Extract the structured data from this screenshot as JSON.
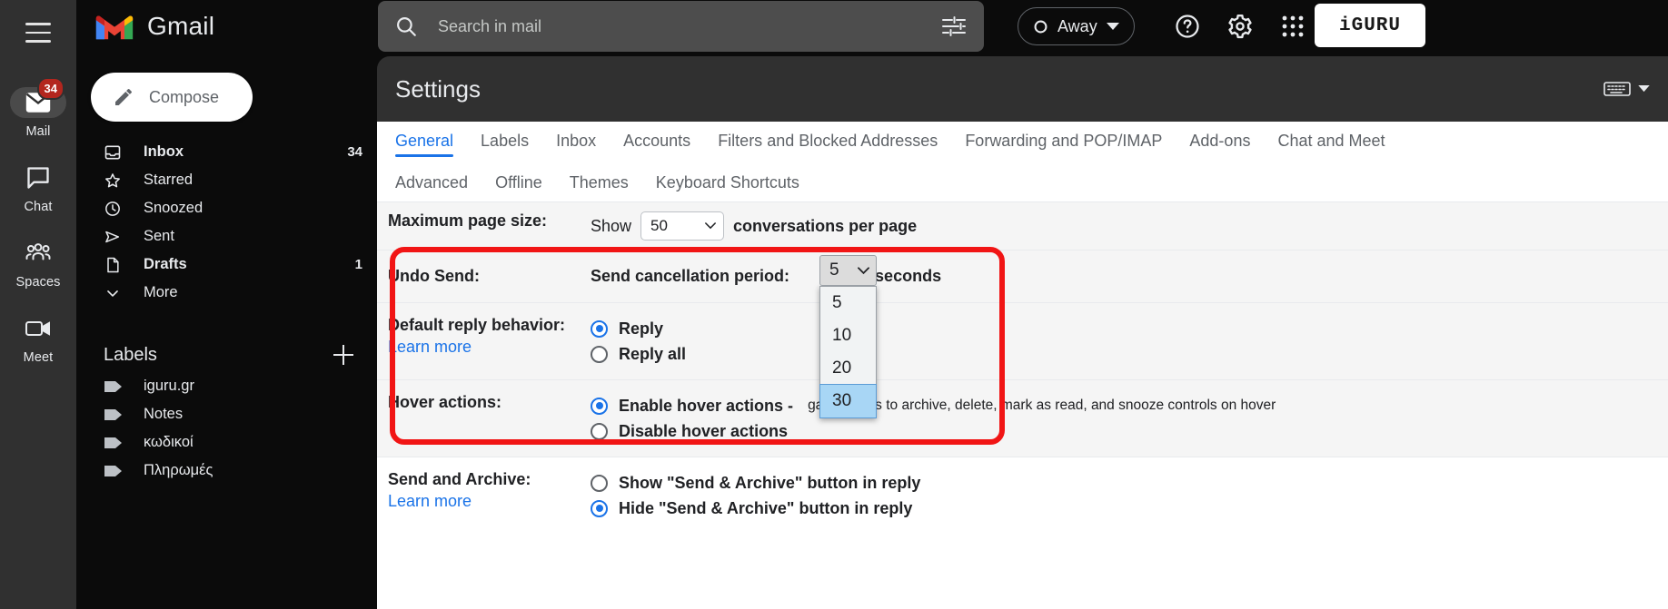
{
  "rail": {
    "menu_icon": "hamburger-icon",
    "items": [
      {
        "label": "Mail",
        "icon": "mail-icon",
        "badge": "34",
        "active": true
      },
      {
        "label": "Chat",
        "icon": "chat-icon",
        "badge": "",
        "active": false
      },
      {
        "label": "Spaces",
        "icon": "spaces-icon",
        "badge": "",
        "active": false
      },
      {
        "label": "Meet",
        "icon": "meet-icon",
        "badge": "",
        "active": false
      }
    ]
  },
  "sidebar": {
    "brand": "Gmail",
    "compose_label": "Compose",
    "nav": [
      {
        "label": "Inbox",
        "count": "34",
        "icon": "inbox-icon",
        "bold": true
      },
      {
        "label": "Starred",
        "count": "",
        "icon": "star-icon",
        "bold": false
      },
      {
        "label": "Snoozed",
        "count": "",
        "icon": "clock-icon",
        "bold": false
      },
      {
        "label": "Sent",
        "count": "",
        "icon": "send-icon",
        "bold": false
      },
      {
        "label": "Drafts",
        "count": "1",
        "icon": "draft-icon",
        "bold": true
      },
      {
        "label": "More",
        "count": "",
        "icon": "chevron-down-icon",
        "bold": false
      }
    ],
    "labels_title": "Labels",
    "labels": [
      {
        "label": "iguru.gr"
      },
      {
        "label": "Notes"
      },
      {
        "label": "κωδικοί"
      },
      {
        "label": "Πληρωμές"
      }
    ]
  },
  "topbar": {
    "search_placeholder": "Search in mail",
    "search_value": "",
    "filter_icon": "search-options-icon",
    "status_label": "Away",
    "help_icon": "help-icon",
    "settings_icon": "gear-icon",
    "apps_icon": "apps-grid-icon",
    "avatar_text": "iGURU"
  },
  "settings": {
    "title": "Settings",
    "keyboard_icon": "keyboard-icon",
    "tabs_row1": [
      {
        "label": "General",
        "selected": true
      },
      {
        "label": "Labels",
        "selected": false
      },
      {
        "label": "Inbox",
        "selected": false
      },
      {
        "label": "Accounts",
        "selected": false
      },
      {
        "label": "Filters and Blocked Addresses",
        "selected": false
      },
      {
        "label": "Forwarding and POP/IMAP",
        "selected": false
      },
      {
        "label": "Add-ons",
        "selected": false
      },
      {
        "label": "Chat and Meet",
        "selected": false
      }
    ],
    "tabs_row2": [
      {
        "label": "Advanced"
      },
      {
        "label": "Offline"
      },
      {
        "label": "Themes"
      },
      {
        "label": "Keyboard Shortcuts"
      }
    ],
    "rows": {
      "page_size": {
        "label": "Maximum page size:",
        "show_text": "Show",
        "value": "50",
        "suffix": "conversations per page"
      },
      "undo_send": {
        "label": "Undo Send:",
        "period_text": "Send cancellation period:",
        "value": "5",
        "seconds_text": "seconds",
        "options": [
          "5",
          "10",
          "20",
          "30"
        ],
        "highlighted_option": "30"
      },
      "reply_behavior": {
        "label": "Default reply behavior:",
        "learn_more": "Learn more",
        "options": [
          {
            "label": "Reply",
            "selected": true
          },
          {
            "label": "Reply all",
            "selected": false
          }
        ]
      },
      "hover_actions": {
        "label": "Hover actions:",
        "enable_label": "Enable hover actions -",
        "enable_rest": "gain access to archive, delete, mark as read, and snooze controls on hover",
        "disable_label": "Disable hover actions"
      },
      "send_archive": {
        "label": "Send and Archive:",
        "learn_more": "Learn more",
        "options": [
          {
            "label": "Show \"Send & Archive\" button in reply",
            "selected": false
          },
          {
            "label": "Hide \"Send & Archive\" button in reply",
            "selected": true
          }
        ]
      }
    }
  },
  "colors": {
    "accent": "#1a73e8",
    "annotation": "#f11515",
    "badge": "#b3261e",
    "highlight": "#a8d6f5"
  }
}
